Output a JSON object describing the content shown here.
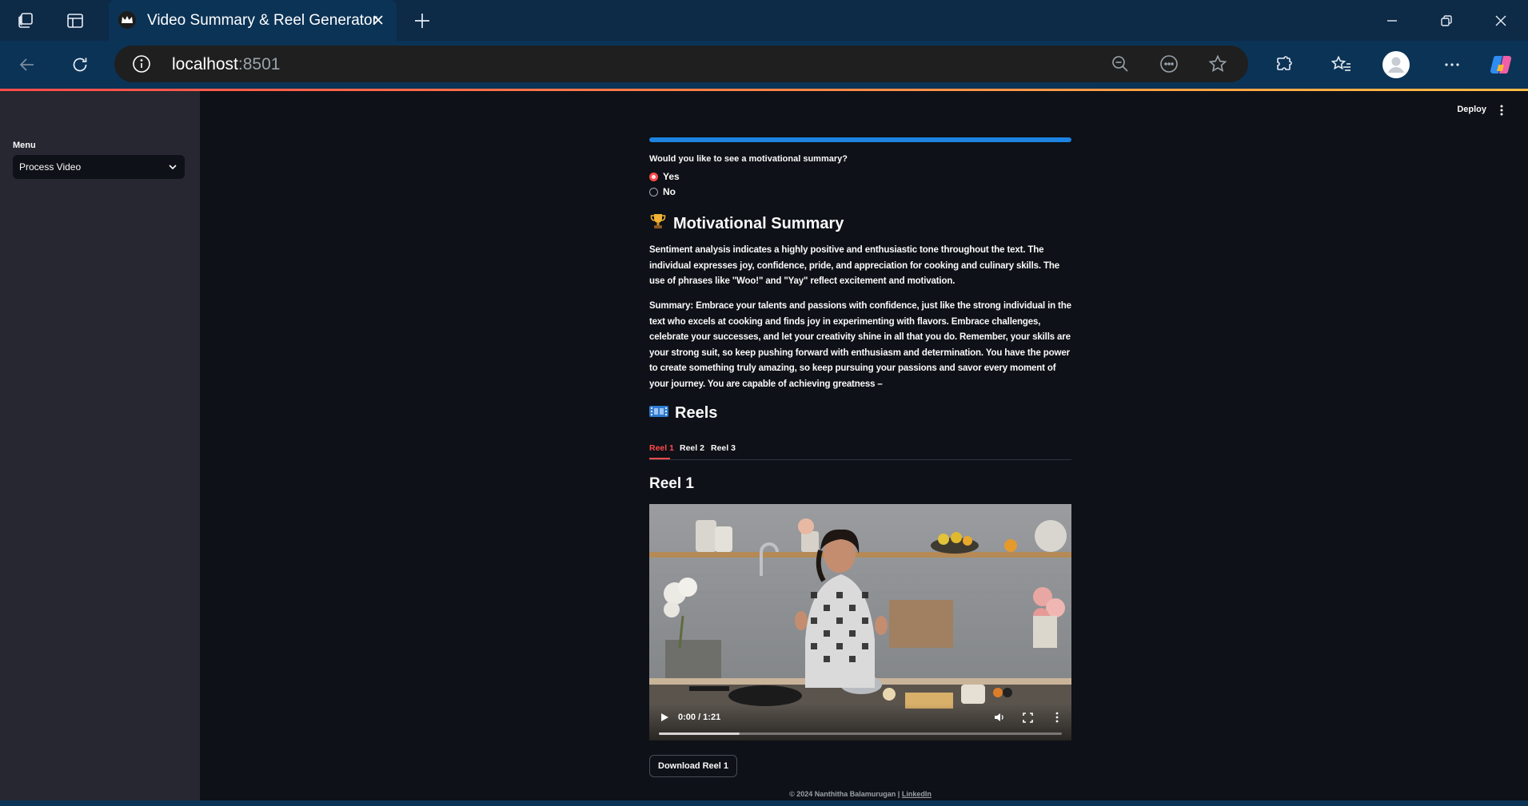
{
  "browser": {
    "tab_title": "Video Summary & Reel Generator",
    "url_host": "localhost",
    "url_port": ":8501"
  },
  "sidebar": {
    "menu_label": "Menu",
    "selected_option": "Process Video"
  },
  "header": {
    "deploy_label": "Deploy"
  },
  "main": {
    "progress": 1.0,
    "question": "Would you like to see a motivational summary?",
    "options": [
      {
        "label": "Yes",
        "selected": true
      },
      {
        "label": "No",
        "selected": false
      }
    ],
    "summary_heading": "Motivational Summary",
    "summary_icon": "trophy-icon",
    "sentiment_text": "Sentiment analysis indicates a highly positive and enthusiastic tone throughout the text. The individual expresses joy, confidence, pride, and appreciation for cooking and culinary skills. The use of phrases like \"Woo!\" and \"Yay\" reflect excitement and motivation.",
    "summary_text": "Summary: Embrace your talents and passions with confidence, just like the strong individual in the text who excels at cooking and finds joy in experimenting with flavors. Embrace challenges, celebrate your successes, and let your creativity shine in all that you do. Remember, your skills are your strong suit, so keep pushing forward with enthusiasm and determination. You have the power to create something truly amazing, so keep pursuing your passions and savor every moment of your journey. You are capable of achieving greatness –",
    "reels_heading": "Reels",
    "reels_icon": "film-strip-icon",
    "tabs": [
      "Reel 1",
      "Reel 2",
      "Reel 3"
    ],
    "active_tab": 0,
    "reel_title": "Reel 1",
    "video": {
      "time": "0:00 / 1:21",
      "buffered": 0.2
    },
    "download_label": "Download Reel 1",
    "footer_text": "© 2024 Nanthitha Balamurugan | ",
    "footer_link": "LinkedIn"
  },
  "colors": {
    "accent": "#ff4b4b",
    "progress": "#1c83e1",
    "background": "#0e1117",
    "sidebar": "#262730"
  }
}
